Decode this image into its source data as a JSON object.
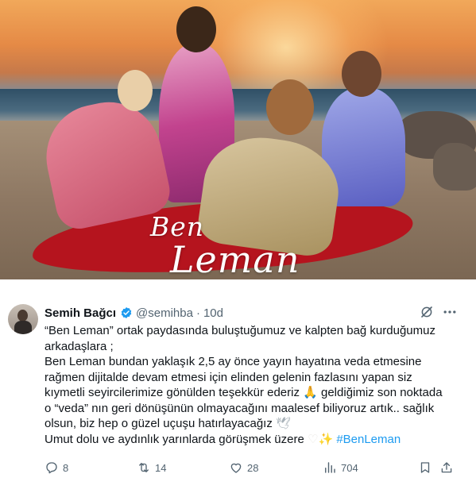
{
  "poster": {
    "logo_line1": "Ben",
    "logo_line2": "Leman"
  },
  "tweet": {
    "author_name": "Semih Bağcı",
    "handle": "@semihba",
    "separator": "·",
    "time": "10d",
    "lines": [
      "“Ben Leman” ortak paydasında buluştuğumuz ve kalpten bağ kurduğumuz",
      "arkadaşlara ;",
      " Ben Leman bundan yaklaşık 2,5 ay önce  yayın hayatına veda etmesine",
      "rağmen dijitalde devam etmesi için elinden gelenin fazlasını yapan siz",
      "kıymetli seyircilerimize gönülden teşekkür ederiz",
      " geldiğimiz son noktada",
      "o “veda” nın geri dönüşünün olmayacağını maalesef biliyoruz artık.. sağlık",
      "olsun, biz hep o güzel uçuşu hatırlayacağız",
      " Umut dolu ve aydınlık yarınlarda görüşmek üzere",
      "#BenLeman"
    ],
    "emojis": {
      "folded_hands": "🙏",
      "dove": "🕊",
      "white_heart": "♡",
      "sparkles": "✨"
    },
    "stats": {
      "replies": "8",
      "reposts": "14",
      "likes": "28",
      "views": "704"
    }
  },
  "colors": {
    "text": "#0f1419",
    "secondary": "#536471",
    "link": "#1d9bf0",
    "verified": "#1d9bf0"
  },
  "icons": [
    "verified-badge-icon",
    "grok-icon",
    "more-icon",
    "reply-icon",
    "repost-icon",
    "like-icon",
    "views-icon",
    "bookmark-icon",
    "share-icon"
  ]
}
